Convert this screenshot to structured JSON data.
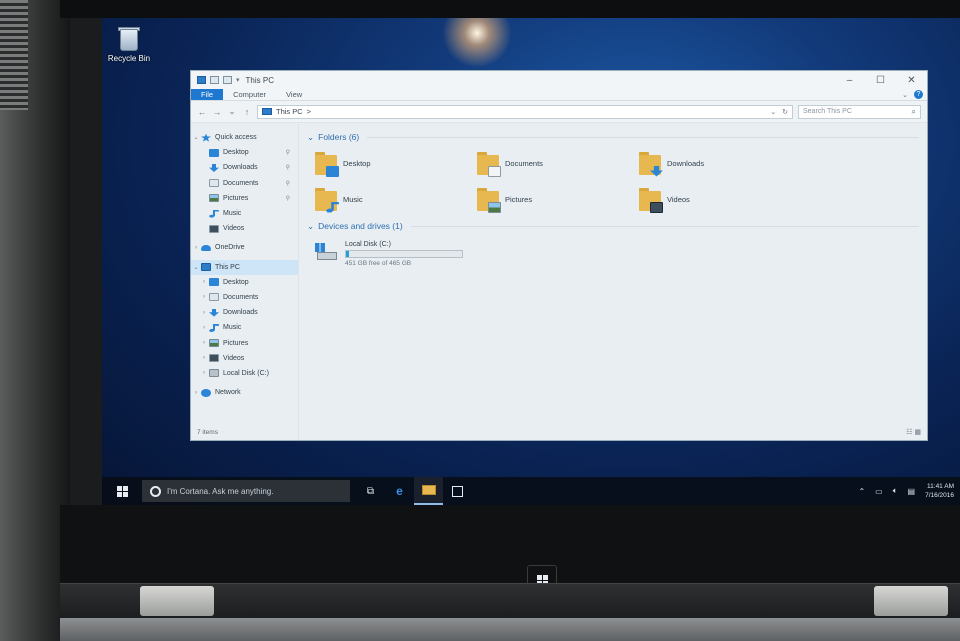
{
  "desktop": {
    "recycle_bin_label": "Recycle Bin"
  },
  "window": {
    "title": "This PC",
    "controls": [
      "–",
      "☐",
      "✕"
    ]
  },
  "ribbon": {
    "tabs": [
      "File",
      "Computer",
      "View"
    ]
  },
  "address_bar": {
    "path": "This PC",
    "separator": ">",
    "search_placeholder": "Search This PC"
  },
  "nav_pane": {
    "quick_access": "Quick access",
    "qa_items": [
      {
        "label": "Desktop",
        "icon": "desktop-icon"
      },
      {
        "label": "Downloads",
        "icon": "download-icon"
      },
      {
        "label": "Documents",
        "icon": "document-icon"
      },
      {
        "label": "Pictures",
        "icon": "picture-icon"
      },
      {
        "label": "Music",
        "icon": "music-icon"
      },
      {
        "label": "Videos",
        "icon": "video-icon"
      }
    ],
    "onedrive": "OneDrive",
    "this_pc": "This PC",
    "pc_items": [
      {
        "label": "Desktop"
      },
      {
        "label": "Documents"
      },
      {
        "label": "Downloads"
      },
      {
        "label": "Music"
      },
      {
        "label": "Pictures"
      },
      {
        "label": "Videos"
      },
      {
        "label": "Local Disk (C:)"
      }
    ],
    "network": "Network"
  },
  "content": {
    "folders_header": "Folders (6)",
    "folders": [
      {
        "label": "Desktop"
      },
      {
        "label": "Documents"
      },
      {
        "label": "Downloads"
      },
      {
        "label": "Music"
      },
      {
        "label": "Pictures"
      },
      {
        "label": "Videos"
      }
    ],
    "devices_header": "Devices and drives (1)",
    "drive": {
      "name": "Local Disk (C:)",
      "free_text": "451 GB free of 465 GB",
      "used_fraction": 0.03
    }
  },
  "status_bar": {
    "items_count": "7 items"
  },
  "taskbar": {
    "cortana_placeholder": "I'm Cortana. Ask me anything.",
    "time": "11:41 AM",
    "date": "7/16/2016"
  },
  "colors": {
    "accent": "#1e78d0",
    "folder": "#e8b850",
    "drive_bar": "#26a0da"
  }
}
